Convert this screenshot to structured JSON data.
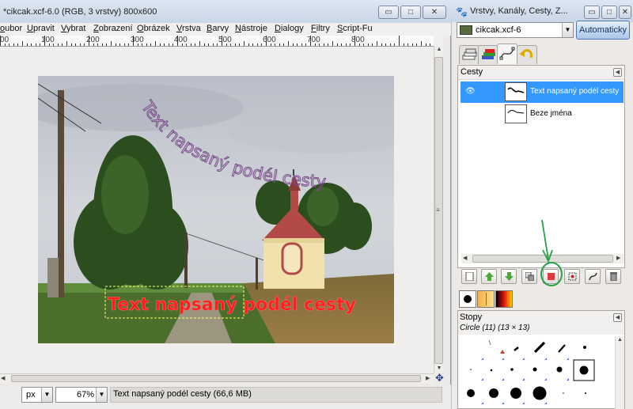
{
  "main_window": {
    "title": "*cikcak.xcf-6.0 (RGB, 3 vrstvy) 800x600",
    "controls": {
      "minimize": "▭",
      "maximize": "□",
      "close": "✕"
    },
    "menu": [
      "oubor",
      "Upravit",
      "Vybrat",
      "Zobrazení",
      "Obrázek",
      "Vrstva",
      "Barvy",
      "Nástroje",
      "Dialogy",
      "Filtry",
      "Script-Fu"
    ],
    "ruler_labels": [
      "100",
      "200",
      "300",
      "400",
      "500",
      "600",
      "700",
      "800"
    ],
    "ruler_start": "00",
    "unit": "px",
    "zoom": "67%",
    "status": "Text napsaný podél cesty (66,6 MB)"
  },
  "image_content": {
    "curved_text": "Text napsaný podél cesty",
    "straight_text": "Text napsaný podél cesty",
    "colors": {
      "straight_text": "#ff1e1e",
      "curved_text_outline": "#7a4a8a"
    }
  },
  "dock": {
    "title": "Vrstvy, Kanály, Cesty, Z...",
    "image_combo": "cikcak.xcf-6",
    "auto_button": "Automaticky",
    "tabs": [
      "layers-tab",
      "channels-tab",
      "paths-tab",
      "undo-tab"
    ],
    "paths_title": "Cesty",
    "paths": [
      {
        "name": "Text napsaný podél cesty",
        "selected": true,
        "visible": true
      },
      {
        "name": "Beze jména",
        "selected": false,
        "visible": false
      }
    ],
    "toolbar_buttons": [
      "new-path",
      "raise-path",
      "lower-path",
      "duplicate-path",
      "path-to-selection",
      "selection-to-path",
      "stroke-path",
      "delete-path"
    ],
    "brushes_title": "Stopy",
    "brush_selected": "Circle (11) (13 × 13)",
    "accent": "#3399ff",
    "annotation_color": "#26a146"
  }
}
